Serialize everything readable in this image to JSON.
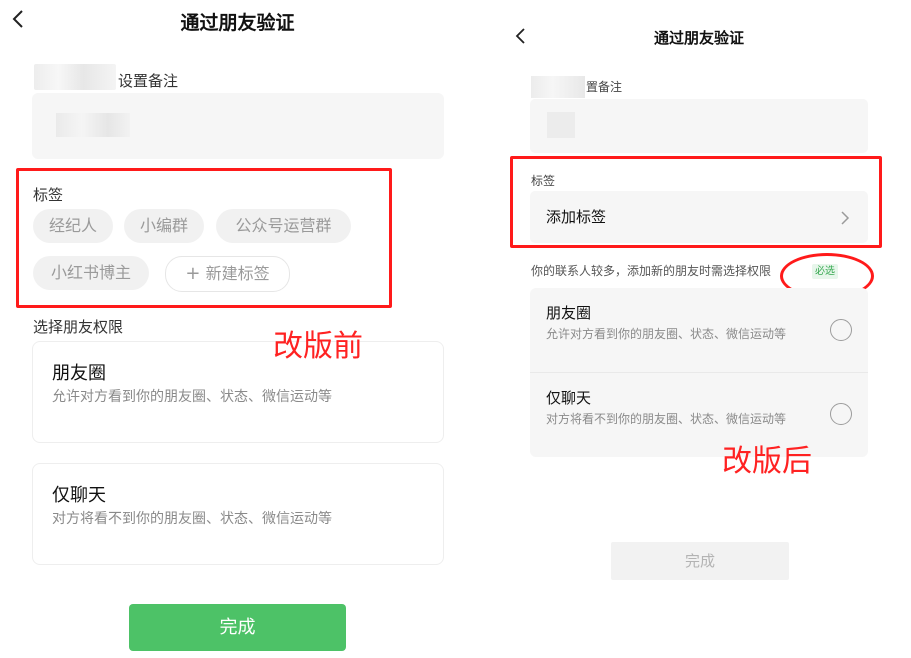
{
  "before": {
    "nav_title": "通过朋友验证",
    "remark_label": "设置备注",
    "tags_label": "标签",
    "tags": [
      "经纪人",
      "小编群",
      "公众号运营群",
      "小红书博主"
    ],
    "new_tag": "新建标签",
    "new_tag_icon": "plus-icon",
    "perm_label": "选择朋友权限",
    "options": [
      {
        "title": "朋友圈",
        "desc": "允许对方看到你的朋友圈、状态、微信运动等"
      },
      {
        "title": "仅聊天",
        "desc": "对方将看不到你的朋友圈、状态、微信运动等"
      }
    ],
    "done": "完成",
    "annotation": "改版前"
  },
  "after": {
    "nav_title": "通过朋友验证",
    "remark_label": "置备注",
    "tags_label": "标签",
    "add_tag": "添加标签",
    "notice": "你的联系人较多，添加新的朋友时需选择权限",
    "required_badge": "必选",
    "options": [
      {
        "title": "朋友圈",
        "desc": "允许对方看到你的朋友圈、状态、微信运动等"
      },
      {
        "title": "仅聊天",
        "desc": "对方将看不到你的朋友圈、状态、微信运动等"
      }
    ],
    "done": "完成",
    "annotation": "改版后"
  },
  "colors": {
    "primary_green": "#4dc267",
    "highlight_red": "#ff1a1a",
    "annotation_red": "#ff2222"
  }
}
